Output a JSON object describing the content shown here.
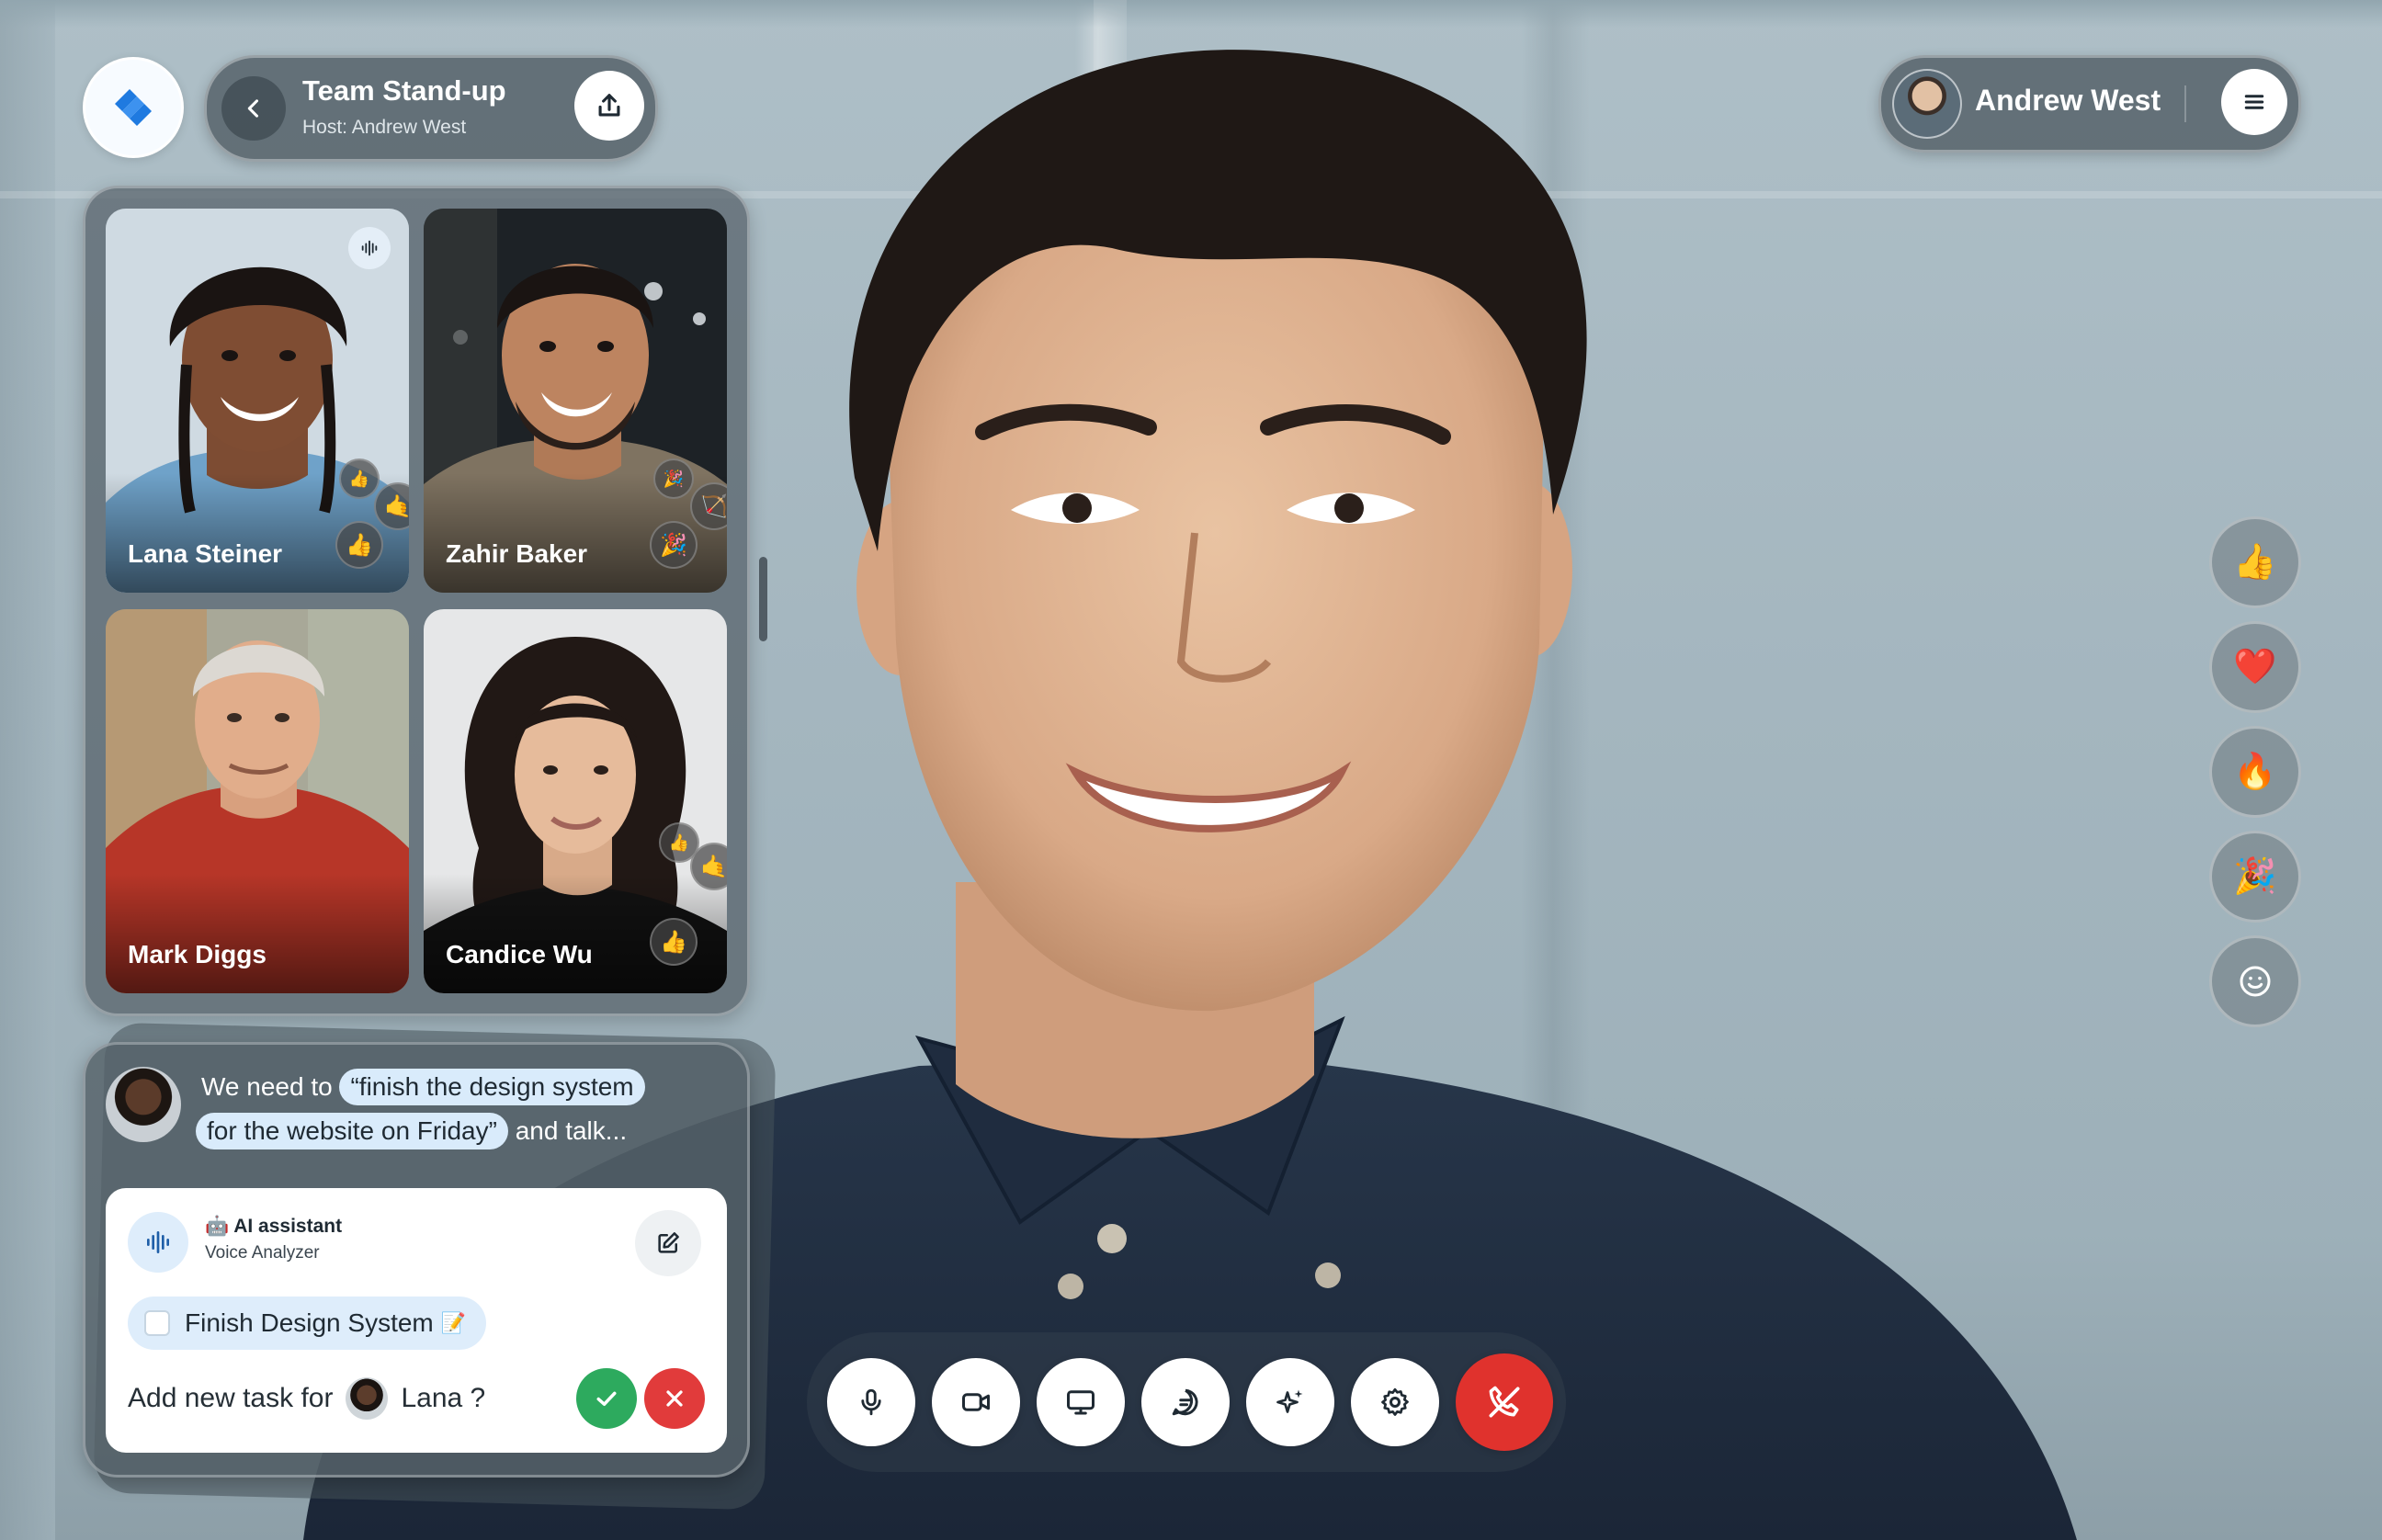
{
  "meeting": {
    "title": "Team Stand-up",
    "host": "Host: Andrew West"
  },
  "user": {
    "name": "Andrew West"
  },
  "participants": [
    {
      "name": "Lana Steiner",
      "reactions": [
        "👍",
        "🤙",
        "👍"
      ],
      "speaking": true
    },
    {
      "name": "Zahir Baker",
      "reactions": [
        "🎉",
        "🏹",
        "🎉"
      ],
      "speaking": false
    },
    {
      "name": "Mark Diggs",
      "reactions": [],
      "speaking": false
    },
    {
      "name": "Candice Wu",
      "reactions": [
        "👍",
        "🤙",
        "👍"
      ],
      "speaking": false
    }
  ],
  "transcript": {
    "prefix": "We need to",
    "highlight_1": "“finish the design system",
    "highlight_2": "for the website on Friday”",
    "suffix": "and talk..."
  },
  "ai_card": {
    "title": "🤖 AI assistant",
    "subtitle": "Voice Analyzer",
    "task": "Finish Design System",
    "task_emoji": "📝",
    "add_prefix": "Add new task for",
    "assignee": "Lana ?"
  },
  "reactions_rail": [
    "👍",
    "❤️",
    "🔥",
    "🎉",
    "smiley-icon"
  ],
  "controls": [
    "microphone-icon",
    "video-camera-icon",
    "screen-share-icon",
    "chat-icon",
    "ai-sparkle-icon",
    "settings-icon",
    "end-call-icon"
  ],
  "colors": {
    "accent_blue": "#1f7ae0",
    "end_call_red": "#e0322d",
    "confirm_green": "#2daa5e",
    "cancel_red": "#e13b3b",
    "highlight_blue": "#d9ebfb"
  }
}
